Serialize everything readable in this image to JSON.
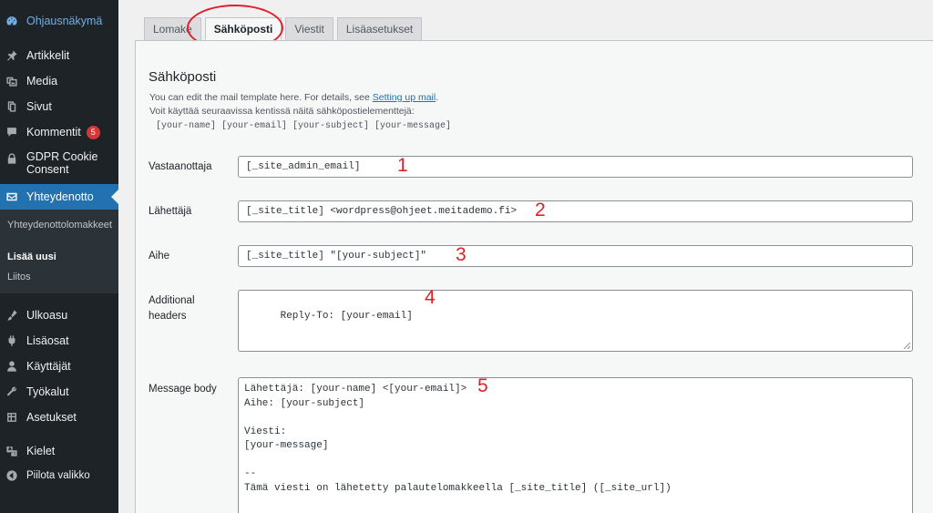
{
  "sidebar": {
    "dashboard": "Ohjausnäkymä",
    "items": [
      {
        "label": "Artikkelit",
        "icon": "pin-icon"
      },
      {
        "label": "Media",
        "icon": "media-icon"
      },
      {
        "label": "Sivut",
        "icon": "pages-icon"
      },
      {
        "label": "Kommentit",
        "icon": "comment-icon",
        "badge": "5"
      },
      {
        "label": "GDPR Cookie Consent",
        "icon": "lock-icon"
      },
      {
        "label": "Yhteydenotto",
        "icon": "mail-icon"
      },
      {
        "label": "Ulkoasu",
        "icon": "brush-icon"
      },
      {
        "label": "Lisäosat",
        "icon": "plugin-icon"
      },
      {
        "label": "Käyttäjät",
        "icon": "user-icon"
      },
      {
        "label": "Työkalut",
        "icon": "wrench-icon"
      },
      {
        "label": "Asetukset",
        "icon": "settings-icon"
      },
      {
        "label": "Kielet",
        "icon": "translate-icon"
      },
      {
        "label": "Piilota valikko",
        "icon": "collapse-icon"
      }
    ],
    "submenu": [
      "Yhteydenottolomakkeet",
      "Lisää uusi",
      "Liitos"
    ]
  },
  "tabs": [
    "Lomake",
    "Sähköposti",
    "Viestit",
    "Lisäasetukset"
  ],
  "section": {
    "title": "Sähköposti",
    "desc_prefix": "You can edit the mail template here. For details, see ",
    "desc_link": "Setting up mail",
    "desc_suffix": ".",
    "desc_line2": "Voit käyttää seuraavissa kentissä näitä sähköpostielementtejä:",
    "tags": "[your-name] [your-email] [your-subject] [your-message]"
  },
  "fields": {
    "to": {
      "label": "Vastaanottaja",
      "value": "[_site_admin_email]"
    },
    "from": {
      "label": "Lähettäjä",
      "value": "[_site_title] <wordpress@ohjeet.meitademo.fi>"
    },
    "subject": {
      "label": "Aihe",
      "value": "[_site_title] \"[your-subject]\""
    },
    "headers": {
      "label": "Additional headers",
      "value": "Reply-To: [your-email]"
    },
    "body": {
      "label": "Message body",
      "value": "Lähettäjä: [your-name] <[your-email]>\nAihe: [your-subject]\n\nViesti:\n[your-message]\n\n--\nTämä viesti on lähetetty palautelomakkeella [_site_title] ([_site_url])"
    }
  },
  "annotations": [
    "1",
    "2",
    "3",
    "4",
    "5"
  ],
  "colors": {
    "sidebar_bg": "#1d2327",
    "active": "#2271b1",
    "badge": "#d63638",
    "annotation": "#e0202a",
    "link": "#2271b1"
  }
}
